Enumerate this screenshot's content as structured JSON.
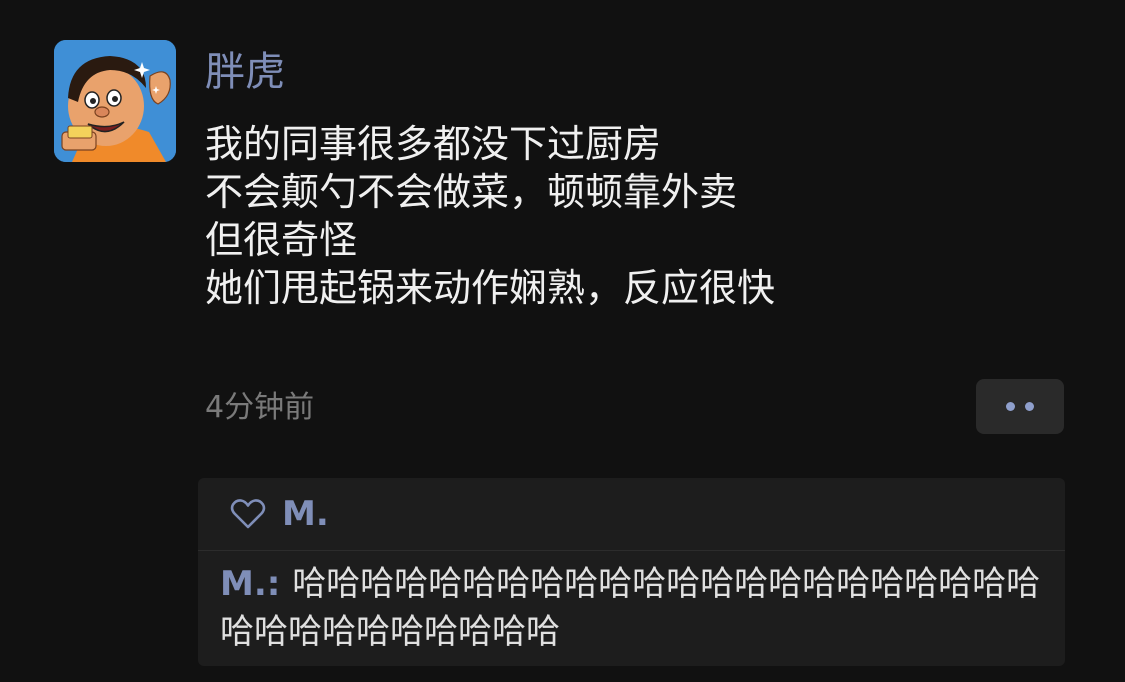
{
  "post": {
    "author_name": "胖虎",
    "content_lines": [
      "我的同事很多都没下过厨房",
      "不会颠勺不会做菜，顿顿靠外卖",
      "但很奇怪",
      "她们甩起锅来动作娴熟，反应很快"
    ],
    "timestamp": "4分钟前",
    "more_icon": "more-dots-icon"
  },
  "interactions": {
    "like_icon": "heart-outline-icon",
    "likers": "M.",
    "comments": [
      {
        "author": "M.",
        "separator": ": ",
        "text": "哈哈哈哈哈哈哈哈哈哈哈哈哈哈哈哈哈哈哈哈哈哈哈哈哈哈哈哈哈哈哈哈"
      }
    ]
  },
  "colors": {
    "background": "#111111",
    "name_accent": "#7f8eb8",
    "text": "#f0f0f0",
    "muted": "#7a7a7a",
    "panel": "#1d1d1d"
  }
}
